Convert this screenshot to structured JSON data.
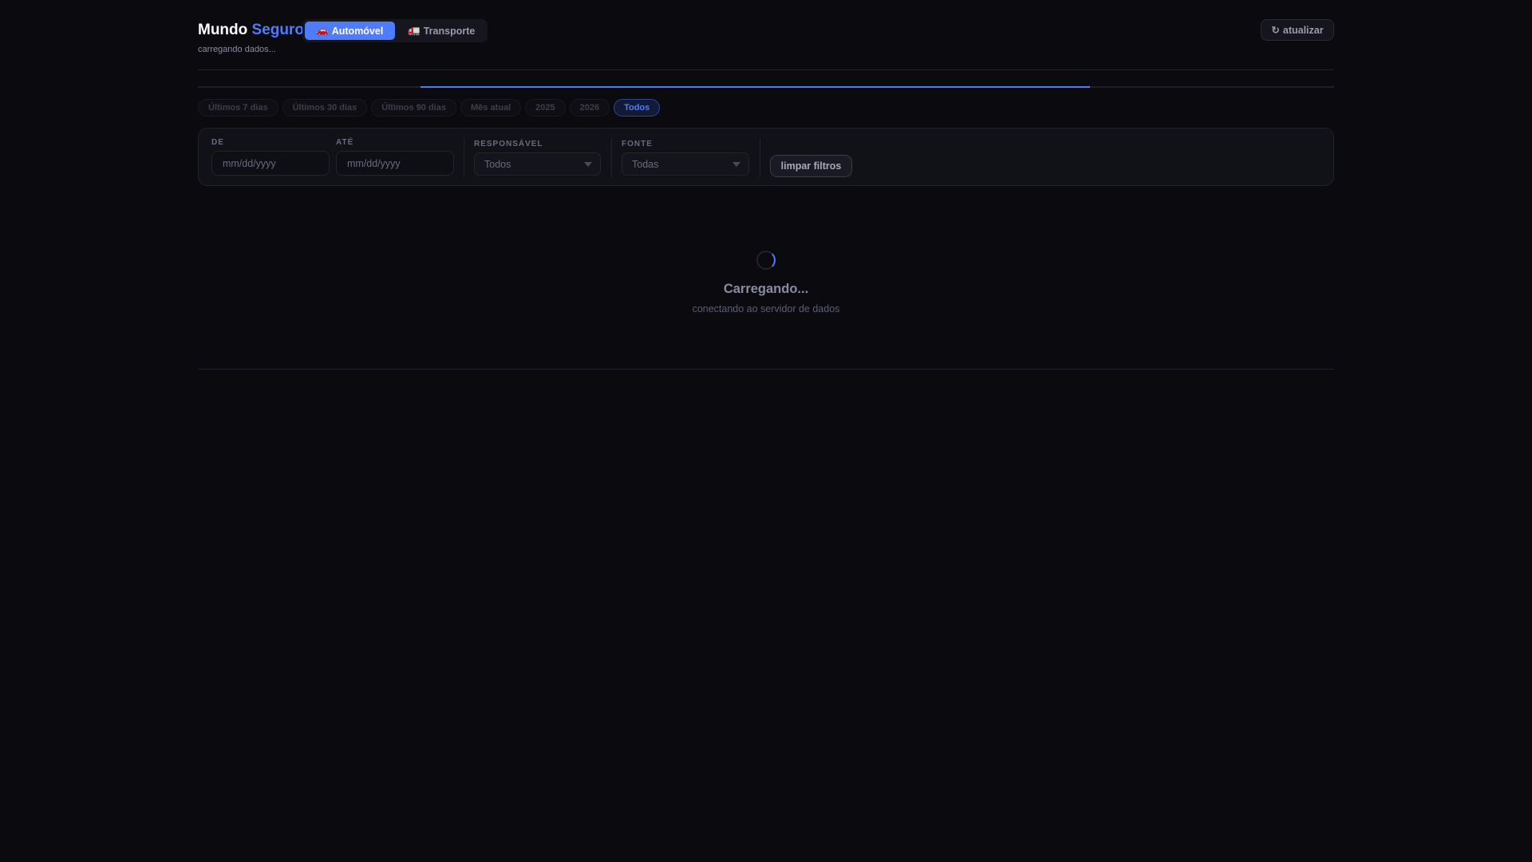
{
  "header": {
    "brand_part1": "Mundo",
    "brand_part2": "Seguro",
    "subtitle": "carregando dados...",
    "tabs": [
      {
        "icon": "🚗",
        "label": "Automóvel",
        "active": true
      },
      {
        "icon": "🚛",
        "label": "Transporte",
        "active": false
      }
    ],
    "refresh_icon": "↻",
    "refresh_label": "atualizar"
  },
  "progress": {
    "start_fraction": 0.196,
    "end_fraction": 0.785
  },
  "period_chips": [
    {
      "label": "Últimos 7 dias"
    },
    {
      "label": "Últimos 30 dias"
    },
    {
      "label": "Últimos 90 dias"
    },
    {
      "label": "Mês atual"
    },
    {
      "label": "2025"
    },
    {
      "label": "2026"
    },
    {
      "label": "Todos",
      "active": true
    }
  ],
  "filters": {
    "from_label": "DE",
    "from_placeholder": "mm/dd/yyyy",
    "to_label": "ATÉ",
    "to_placeholder": "mm/dd/yyyy",
    "owner_label": "RESPONSÁVEL",
    "owner_value": "Todos",
    "source_label": "FONTE",
    "source_value": "Todas",
    "clear_label": "limpar filtros"
  },
  "loading": {
    "title": "Carregando...",
    "subtitle": "conectando ao servidor de dados"
  },
  "colors": {
    "accent": "#4f7cff",
    "background": "#0a0a0f"
  }
}
